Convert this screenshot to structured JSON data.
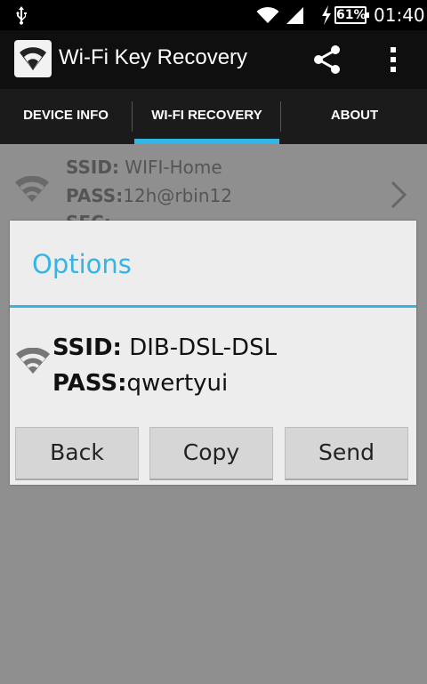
{
  "status_bar": {
    "battery": "61%",
    "time": "01:40",
    "icons": [
      "usb-icon",
      "wifi-icon",
      "signal-icon",
      "charging-icon",
      "battery-icon"
    ]
  },
  "app_bar": {
    "title": "Wi-Fi Key Recovery",
    "icons": [
      "app-icon",
      "share-icon",
      "more-icon"
    ]
  },
  "tabs": [
    {
      "label": "DEVICE INFO"
    },
    {
      "label": "WI-FI RECOVERY"
    },
    {
      "label": "ABOUT"
    }
  ],
  "list": {
    "items": [
      {
        "ssid_label": "SSID:",
        "ssid": " WIFI-Home",
        "pass_label": "PASS:",
        "pass": "12h@rbin12",
        "sec_label": "SEC:"
      }
    ]
  },
  "dialog": {
    "title": "Options",
    "ssid_label": "SSID:",
    "ssid": " DIB-DSL-DSL",
    "pass_label": "PASS:",
    "pass": "qwertyui",
    "buttons": [
      {
        "label": "Back"
      },
      {
        "label": "Copy"
      },
      {
        "label": "Send"
      }
    ]
  },
  "colors": {
    "accent": "#33b5e5",
    "action_bar": "#0f0f0f",
    "tab_bar": "#1b1b1b",
    "dim_background": "#8f8f8f",
    "dialog_background": "#ededed"
  }
}
